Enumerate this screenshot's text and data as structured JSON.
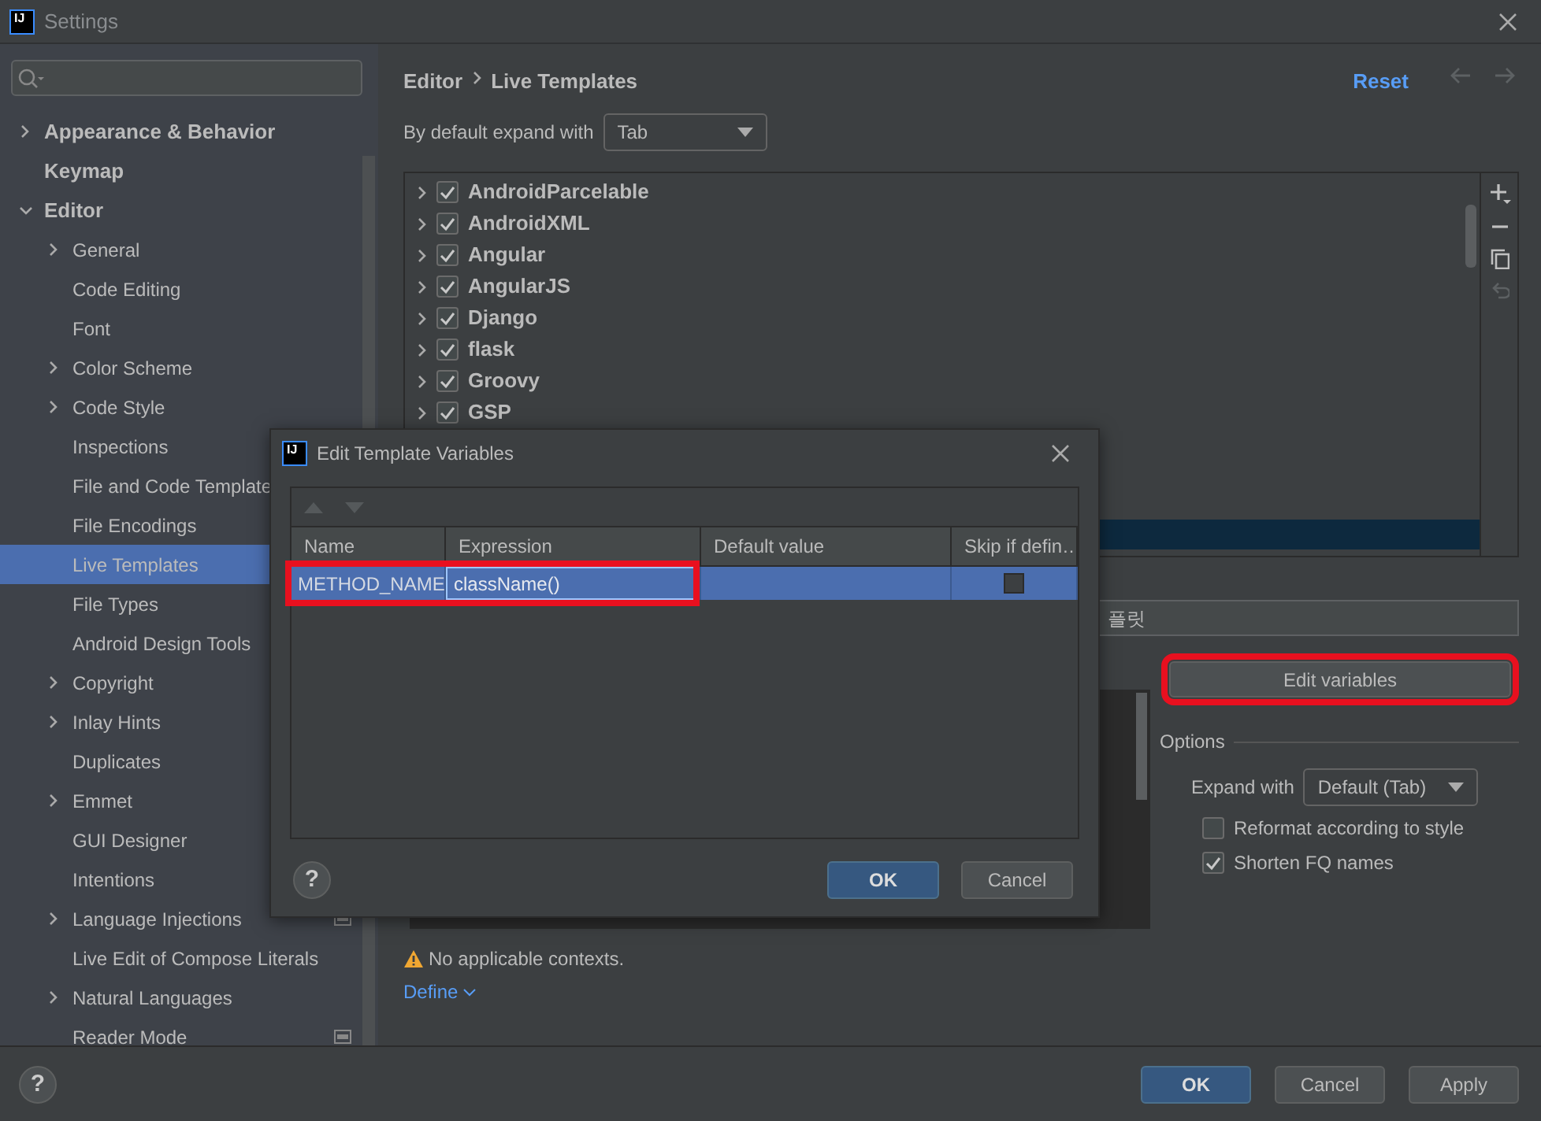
{
  "window": {
    "title": "Settings",
    "logo": "IJ"
  },
  "sidebar": {
    "items": [
      {
        "label": "Appearance & Behavior",
        "expanded": false,
        "selected": false
      },
      {
        "label": "Keymap",
        "selected": false
      },
      {
        "label": "Editor",
        "expanded": true,
        "selected": false,
        "children": [
          {
            "label": "General",
            "expanded": false,
            "selected": false
          },
          {
            "label": "Code Editing",
            "selected": false
          },
          {
            "label": "Font",
            "selected": false
          },
          {
            "label": "Color Scheme",
            "expanded": false,
            "selected": false
          },
          {
            "label": "Code Style",
            "expanded": false,
            "selected": false
          },
          {
            "label": "Inspections",
            "selected": false
          },
          {
            "label": "File and Code Template",
            "selected": false
          },
          {
            "label": "File Encodings",
            "selected": false
          },
          {
            "label": "Live Templates",
            "selected": true
          },
          {
            "label": "File Types",
            "selected": false
          },
          {
            "label": "Android Design Tools",
            "selected": false
          },
          {
            "label": "Copyright",
            "expanded": false,
            "selected": false
          },
          {
            "label": "Inlay Hints",
            "expanded": false,
            "selected": false
          },
          {
            "label": "Duplicates",
            "selected": false
          },
          {
            "label": "Emmet",
            "expanded": false,
            "selected": false
          },
          {
            "label": "GUI Designer",
            "selected": false
          },
          {
            "label": "Intentions",
            "selected": false
          },
          {
            "label": "Language Injections",
            "expanded": false,
            "selected": false,
            "project_icon": true
          },
          {
            "label": "Live Edit of Compose Literals",
            "selected": false
          },
          {
            "label": "Natural Languages",
            "expanded": false,
            "selected": false
          },
          {
            "label": "Reader Mode",
            "selected": false,
            "project_icon": true
          }
        ]
      }
    ]
  },
  "breadcrumb": [
    "Editor",
    "Live Templates"
  ],
  "reset": "Reset",
  "expand_default": {
    "label": "By default expand with",
    "value": "Tab"
  },
  "templates": {
    "groups": [
      {
        "name": "AndroidParcelable",
        "checked": true
      },
      {
        "name": "AndroidXML",
        "checked": true
      },
      {
        "name": "Angular",
        "checked": true
      },
      {
        "name": "AngularJS",
        "checked": true
      },
      {
        "name": "Django",
        "checked": true
      },
      {
        "name": "flask",
        "checked": true
      },
      {
        "name": "Groovy",
        "checked": true
      },
      {
        "name": "GSP",
        "checked": true
      }
    ],
    "lower_row": {
      "selected": true
    }
  },
  "description": {
    "value": "플릿"
  },
  "edit_variables": {
    "label": "Edit variables",
    "highlighted": true
  },
  "options": {
    "title": "Options",
    "expand_with": {
      "label": "Expand with",
      "value": "Default (Tab)"
    },
    "checkboxes": [
      {
        "label": "Reformat according to style",
        "checked": false
      },
      {
        "label": "Shorten FQ names",
        "checked": true
      }
    ]
  },
  "warning": "No applicable contexts.",
  "define": "Define",
  "help": "?",
  "footer_buttons": [
    {
      "label": "OK",
      "primary": true
    },
    {
      "label": "Cancel",
      "primary": false
    },
    {
      "label": "Apply",
      "primary": false
    }
  ],
  "dialog": {
    "title": "Edit Template Variables",
    "logo": "IJ",
    "columns": [
      "Name",
      "Expression",
      "Default value",
      "Skip if defin…"
    ],
    "rows": [
      {
        "name": "METHOD_NAME",
        "expression": "className()",
        "skip_if_defined": false,
        "selected": true,
        "highlighted": true
      }
    ],
    "help": "?",
    "buttons": [
      {
        "label": "OK",
        "primary": true
      },
      {
        "label": "Cancel",
        "primary": false
      }
    ]
  }
}
